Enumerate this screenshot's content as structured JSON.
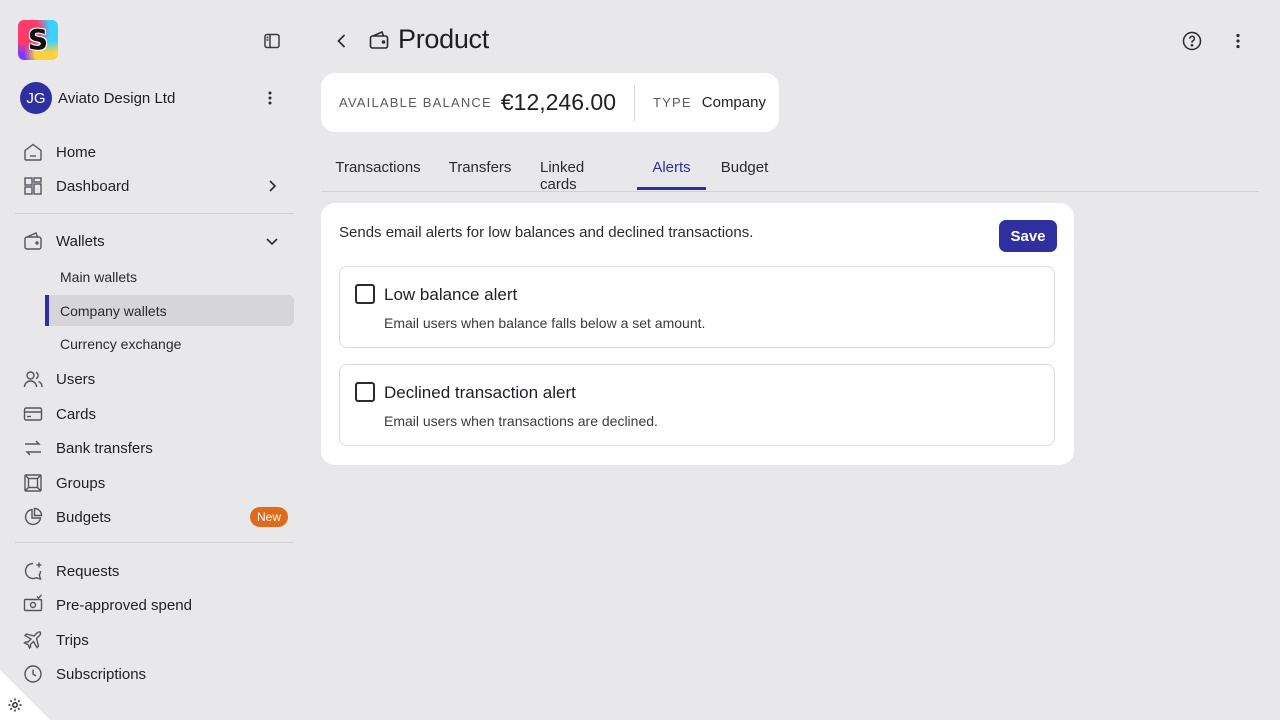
{
  "app": {
    "logo_letter": "S"
  },
  "org": {
    "initials": "JG",
    "name": "Aviato Design Ltd"
  },
  "nav": {
    "home": "Home",
    "dashboard": "Dashboard",
    "wallets": "Wallets",
    "wallets_sub": [
      "Main wallets",
      "Company wallets",
      "Currency exchange"
    ],
    "users": "Users",
    "cards": "Cards",
    "bank_transfers": "Bank transfers",
    "groups": "Groups",
    "budgets": "Budgets",
    "budgets_badge": "New",
    "requests": "Requests",
    "preapproved": "Pre-approved spend",
    "trips": "Trips",
    "subscriptions": "Subscriptions"
  },
  "header": {
    "title": "Product"
  },
  "balance": {
    "label": "AVAILABLE BALANCE",
    "value": "€12,246.00",
    "type_label": "TYPE",
    "type_value": "Company"
  },
  "tabs": [
    "Transactions",
    "Transfers",
    "Linked cards",
    "Alerts",
    "Budget"
  ],
  "active_tab": "Alerts",
  "alerts_panel": {
    "description": "Sends email alerts for low balances and declined transactions.",
    "save_label": "Save",
    "items": [
      {
        "title": "Low balance alert",
        "description": "Email users when balance falls below a set amount.",
        "checked": false
      },
      {
        "title": "Declined transaction alert",
        "description": "Email users when transactions are declined.",
        "checked": false
      }
    ]
  },
  "colors": {
    "accent": "#2f2f9f",
    "badge": "#e0691a",
    "background": "#e8e8ea"
  }
}
